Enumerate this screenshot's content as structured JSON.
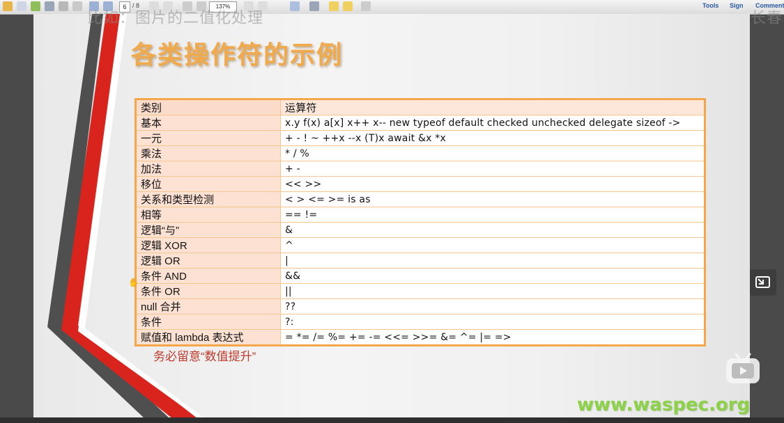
{
  "toolbar": {
    "page_number": "6",
    "page_total": "/ 8",
    "zoom": "137%",
    "tools_label": "Tools",
    "sign_label": "Sign",
    "comment_label": "Comment"
  },
  "overlay": {
    "subtitle_text": "比如：图片的二值化处理",
    "right_text": "长春"
  },
  "slide": {
    "title": "各类操作符的示例",
    "note": "务必留意“数值提升”",
    "website": "www.waspec.org"
  },
  "table": {
    "headers": [
      "类别",
      "运算符"
    ],
    "rows": [
      [
        "基本",
        "x.y  f(x)  a[x]  x++  x--  new  typeof  default  checked  unchecked  delegate  sizeof  ->"
      ],
      [
        "一元",
        "+  -  !  ~  ++x  --x  (T)x  await  &x  *x"
      ],
      [
        "乘法",
        "*  /  %"
      ],
      [
        "加法",
        "+  -"
      ],
      [
        "移位",
        "<<  >>"
      ],
      [
        "关系和类型检测",
        "<  >  <=  >=  is  as"
      ],
      [
        "相等",
        "==  !="
      ],
      [
        "逻辑“与”",
        "&"
      ],
      [
        "逻辑 XOR",
        "^"
      ],
      [
        "逻辑 OR",
        "|"
      ],
      [
        "条件 AND",
        "&&"
      ],
      [
        "条件 OR",
        "||"
      ],
      [
        "null 合并",
        "??"
      ],
      [
        "条件",
        "?:"
      ],
      [
        "赋值和 lambda 表达式",
        "=  *=  /=  %=  +=  -=  <<=  >>=  &=  ^=  |=  =>"
      ]
    ]
  },
  "colors": {
    "title": "#f0a94b",
    "table_border": "#f6a64a",
    "table_label_bg": "#fde1d2",
    "note": "#c0392b",
    "website": "#8dd14a",
    "stripe_red": "#d8241c",
    "stripe_gray": "#4f4f4f"
  }
}
